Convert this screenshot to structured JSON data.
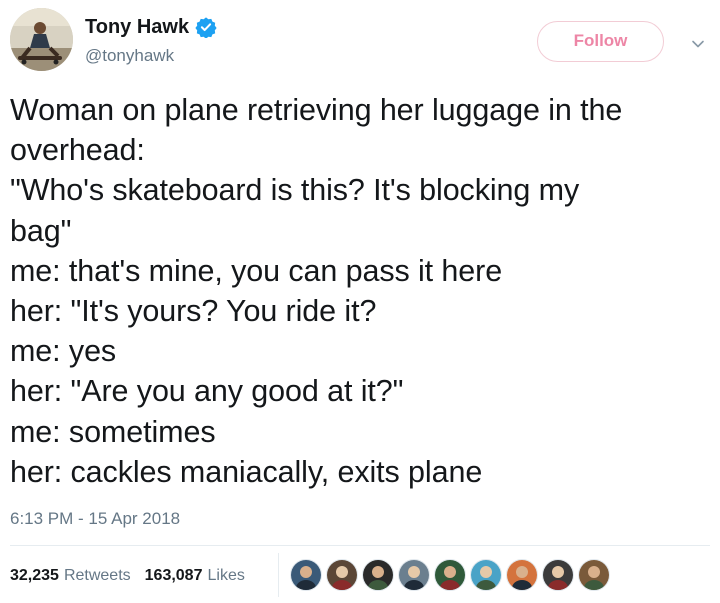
{
  "user": {
    "display_name": "Tony Hawk",
    "handle": "@tonyhawk",
    "verified": true,
    "avatar_icon": "skateboarder-avatar-icon"
  },
  "follow_button": {
    "label": "Follow"
  },
  "menu": {
    "icon": "chevron-down-icon"
  },
  "tweet": {
    "lines": [
      "Woman on plane retrieving her luggage in the",
      "overhead:",
      "\"Who's skateboard is this? It's blocking my",
      "bag\"",
      "me: that's mine, you can pass it here",
      "her: \"It's yours? You ride it?",
      "me: yes",
      "her: \"Are you any good at it?\"",
      "me: sometimes",
      "her: cackles maniacally, exits plane"
    ],
    "timestamp": "6:13 PM - 15 Apr 2018"
  },
  "stats": {
    "retweets_count": "32,235",
    "retweets_label": "Retweets",
    "likes_count": "163,087",
    "likes_label": "Likes"
  },
  "colors": {
    "follow_accent": "#e0245e",
    "verified_blue": "#1da1f2",
    "secondary_text": "#657786",
    "primary_text": "#14171a"
  },
  "liker_avatars": [
    {
      "icon": "liker-avatar-icon",
      "color": "#3a5a78"
    },
    {
      "icon": "liker-avatar-icon",
      "color": "#5b4636"
    },
    {
      "icon": "liker-avatar-icon",
      "color": "#2a2a2a"
    },
    {
      "icon": "liker-avatar-icon",
      "color": "#6b7f8f"
    },
    {
      "icon": "liker-avatar-icon",
      "color": "#2f5a3a"
    },
    {
      "icon": "liker-avatar-icon",
      "color": "#4aa3c7"
    },
    {
      "icon": "liker-avatar-icon",
      "color": "#d4733d"
    },
    {
      "icon": "liker-avatar-icon",
      "color": "#3b3b3b"
    },
    {
      "icon": "liker-avatar-icon",
      "color": "#7a5a3a"
    }
  ]
}
